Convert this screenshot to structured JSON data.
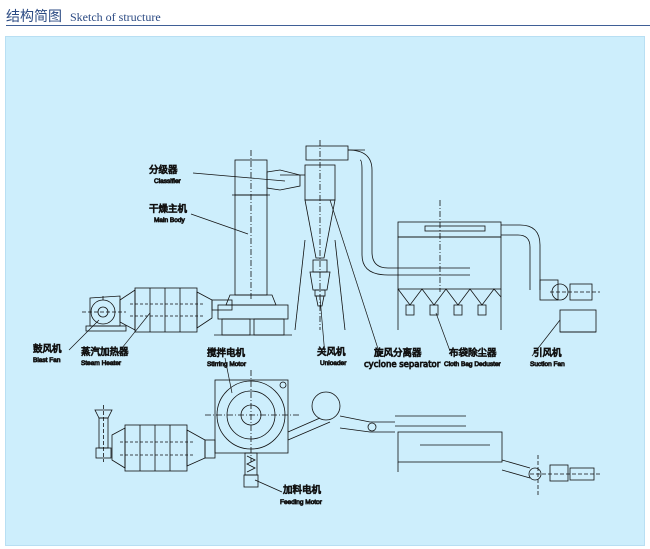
{
  "header": {
    "title_cn": "结构简图",
    "title_en": "Sketch of structure"
  },
  "labels": [
    {
      "id": "classifier",
      "cn": "分级器",
      "en": "Classifier"
    },
    {
      "id": "main_body",
      "cn": "干燥主机",
      "en": "Main Body"
    },
    {
      "id": "blast_fan",
      "cn": "鼓风机",
      "en": "Blast Fan"
    },
    {
      "id": "steam_heater",
      "cn": "蒸汽加热器",
      "en": "Steam Heater"
    },
    {
      "id": "stirring_motor",
      "cn": "搅拌电机",
      "en": "Stirring Motor"
    },
    {
      "id": "unloader",
      "cn": "关风机",
      "en": "Unloader"
    },
    {
      "id": "cyclone_separator",
      "cn": "旋风分离器",
      "en": "cyclone separator"
    },
    {
      "id": "cloth_bag",
      "cn": "布袋除尘器",
      "en": "Cloth Bag Deduster"
    },
    {
      "id": "suction_fan",
      "cn": "引风机",
      "en": "Suction Fan"
    },
    {
      "id": "feeding_motor",
      "cn": "加料电机",
      "en": "Feeding Motor"
    }
  ],
  "colors": {
    "panel": "#cdeefc",
    "line": "#111111",
    "header_text": "#2b4a83"
  }
}
